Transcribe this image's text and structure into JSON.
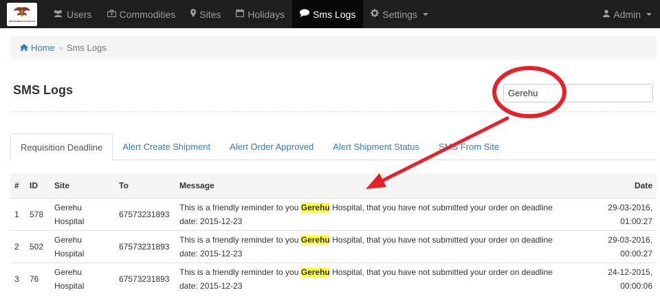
{
  "navbar": {
    "logo_text": "DEPARTMENT OF HEALTH",
    "items": [
      {
        "label": "Users",
        "icon": "users-icon"
      },
      {
        "label": "Commodities",
        "icon": "briefcase-icon"
      },
      {
        "label": "Sites",
        "icon": "map-marker-icon"
      },
      {
        "label": "Holidays",
        "icon": "calendar-icon"
      },
      {
        "label": "Sms Logs",
        "icon": "comment-icon"
      },
      {
        "label": "Settings",
        "icon": "gear-icon"
      }
    ],
    "active": "Sms Logs",
    "user": {
      "label": "Admin",
      "icon": "user-icon"
    }
  },
  "breadcrumb": {
    "home": "Home",
    "separator": "»",
    "current": "Sms Logs"
  },
  "page": {
    "title": "SMS Logs"
  },
  "search": {
    "value": "Gerehu"
  },
  "tabs": [
    {
      "label": "Requisition Deadline",
      "active": true
    },
    {
      "label": "Alert Create Shipment",
      "active": false
    },
    {
      "label": "Alert Order Approved",
      "active": false
    },
    {
      "label": "Alert Shipment Status",
      "active": false
    },
    {
      "label": "SMS From Site",
      "active": false
    }
  ],
  "table": {
    "headers": {
      "num": "#",
      "id": "ID",
      "site": "Site",
      "to": "To",
      "message": "Message",
      "date": "Date"
    },
    "rows": [
      {
        "num": "1",
        "id": "578",
        "site_line1": "Gerehu",
        "site_line2": "Hospital",
        "to": "67573231893",
        "msg_before": "This is a friendly reminder to you ",
        "msg_highlight": "Gerehu",
        "msg_after": " Hospital, that you have not submitted your order on deadline",
        "msg_line2": "date: 2015-12-23",
        "date_line1": "29-03-2016,",
        "date_line2": "01:00:27"
      },
      {
        "num": "2",
        "id": "502",
        "site_line1": "Gerehu",
        "site_line2": "Hospital",
        "to": "67573231893",
        "msg_before": "This is a friendly reminder to you ",
        "msg_highlight": "Gerehu",
        "msg_after": " Hospital, that you have not submitted your order on deadline",
        "msg_line2": "date: 2015-12-23",
        "date_line1": "29-03-2016,",
        "date_line2": "00:00:27"
      },
      {
        "num": "3",
        "id": "76",
        "site_line1": "Gerehu",
        "site_line2": "Hospital",
        "to": "67573231893",
        "msg_before": "This is a friendly reminder to you ",
        "msg_highlight": "Gerehu",
        "msg_after": " Hospital, that you have not submitted your order on deadline",
        "msg_line2": "date: 2015-12-23",
        "date_line1": "24-12-2015,",
        "date_line2": "00:00:06"
      }
    ]
  },
  "colors": {
    "navbar_bg": "#1e1e1e",
    "link": "#337ab7",
    "highlight": "#ffff3d",
    "annotation": "#e8202a"
  }
}
